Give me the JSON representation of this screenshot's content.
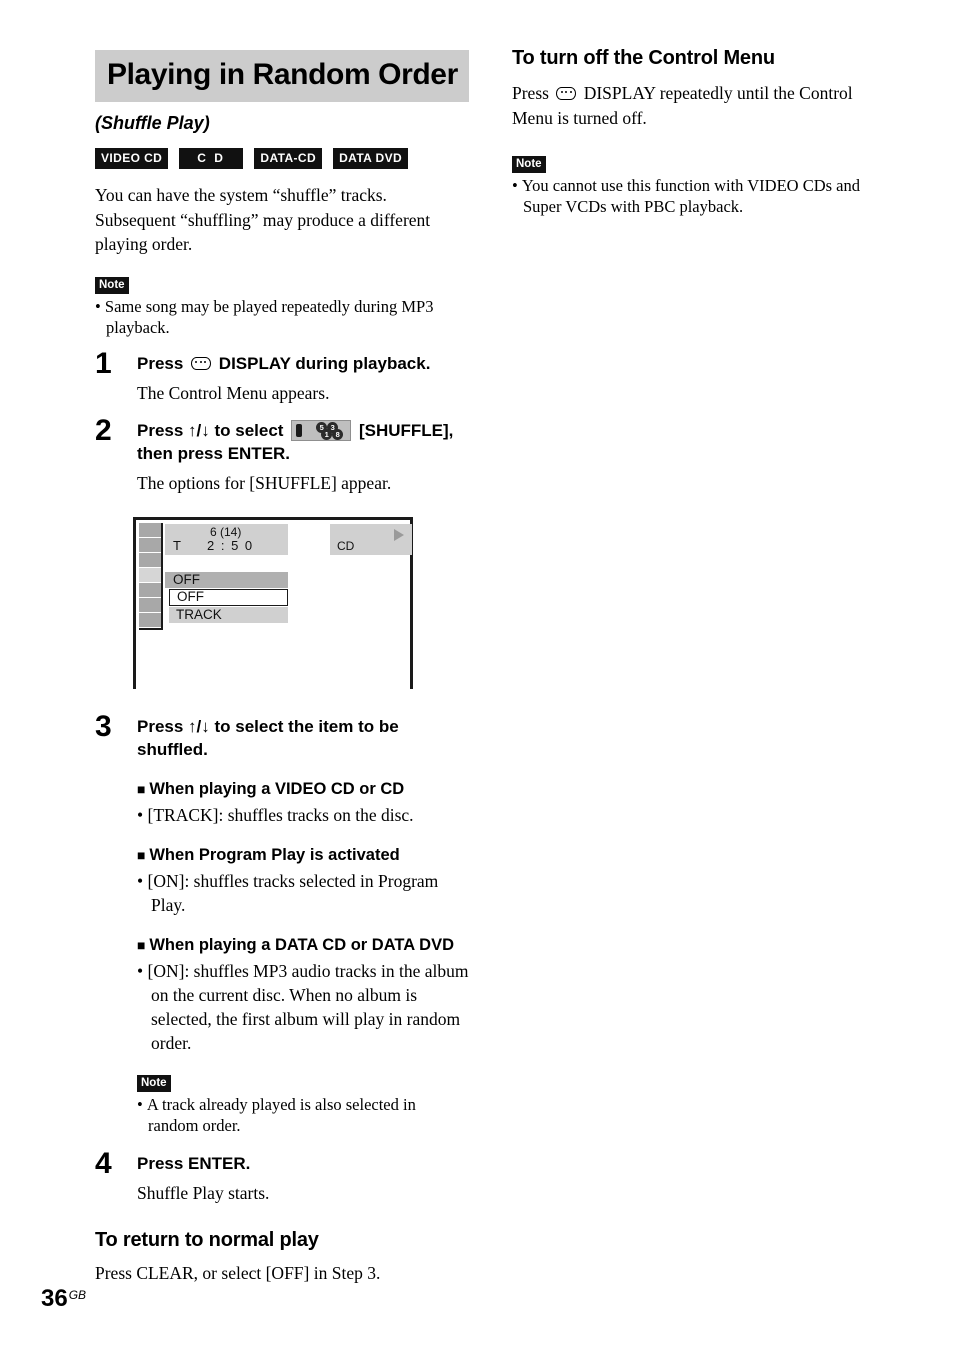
{
  "page": {
    "number": "36",
    "region_code": "GB"
  },
  "left": {
    "title": "Playing in Random Order",
    "subtitle": "(Shuffle Play)",
    "badges": [
      {
        "label": "VIDEO CD",
        "name": "badge-video-cd"
      },
      {
        "label": "C D",
        "name": "badge-cd"
      },
      {
        "label": "DATA-CD",
        "name": "badge-data-cd"
      },
      {
        "label": "DATA DVD",
        "name": "badge-data-dvd"
      }
    ],
    "intro": "You can have the system “shuffle” tracks. Subsequent “shuffling” may produce a different playing order.",
    "note_label": "Note",
    "note_items": [
      "Same song may be played repeatedly during MP3 playback."
    ],
    "steps": [
      {
        "num": "1",
        "title_before": "Press",
        "title_after": "DISPLAY during playback.",
        "desc": "The Control Menu appears."
      },
      {
        "num": "2",
        "title_before": "Press ↑/↓ to select",
        "title_after": "[SHUFFLE], then press ENTER.",
        "desc": "The options for [SHUFFLE] appear."
      },
      {
        "num": "3",
        "title": "Press ↑/↓ to select the item to be shuffled."
      },
      {
        "num": "4",
        "title": "Press ENTER.",
        "desc": "Shuffle Play starts."
      }
    ],
    "subsections": [
      {
        "heading": "When playing a VIDEO CD or CD",
        "bullets": [
          "[TRACK]: shuffles tracks on the disc."
        ]
      },
      {
        "heading": "When Program Play is activated",
        "bullets": [
          "[ON]: shuffles tracks selected in Program Play."
        ]
      },
      {
        "heading": "When playing a DATA CD or DATA DVD",
        "bullets": [
          "[ON]: shuffles MP3 audio tracks in the album on the current disc. When no album is selected, the first album will play in random order."
        ]
      }
    ],
    "note2_label": "Note",
    "note2_items": [
      "A track already played is also selected in random order."
    ],
    "return_heading": "To return to normal play",
    "return_body": "Press CLEAR, or select [OFF] in Step 3."
  },
  "tv_screen": {
    "track_info": "6 (14)",
    "time_label": "T",
    "time_value": "2 : 5 0",
    "disc_type": "CD",
    "play_icon": "play-triangle-icon",
    "current_row": "OFF",
    "options": [
      {
        "label": "OFF",
        "selected": true
      },
      {
        "label": "TRACK",
        "selected": false
      }
    ],
    "sidebar_cells": 7,
    "sidebar_selected_index": 3
  },
  "shuffle_icon": {
    "balls": [
      "5",
      "3",
      "1",
      "8"
    ]
  },
  "right": {
    "heading": "To turn off the Control Menu",
    "body_before": "Press",
    "body_after": "DISPLAY repeatedly until the Control Menu is turned off.",
    "note_label": "Note",
    "note_items": [
      "You cannot use this function with VIDEO CDs and Super VCDs with PBC playback."
    ]
  },
  "colors": {
    "banner_bg": "#cccccc",
    "badge_bg": "#111111",
    "tv_panel": "#d0d0d0",
    "tv_highlight": "#b0b0b0",
    "tv_sidebar": "#a8a8a8"
  }
}
